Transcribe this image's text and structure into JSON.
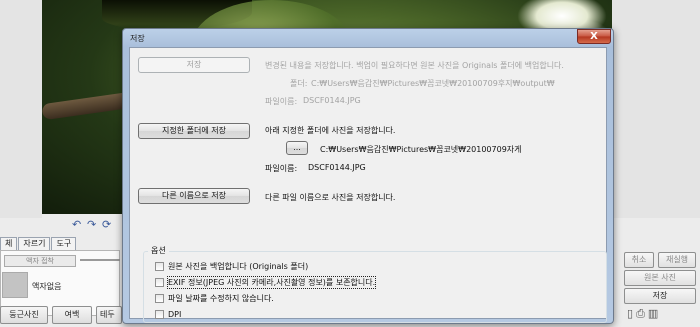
{
  "background": {
    "tabs": [
      "체",
      "자르기",
      "도구"
    ],
    "frame_select_placeholder": "액자 접착",
    "thumbnail_label": "액자없음",
    "bottom_buttons": [
      "둥근사진",
      "여백",
      "테두"
    ],
    "right_buttons": {
      "cancel": "취소",
      "reapply": "재실행",
      "original": "원본 사진",
      "save": "저장"
    },
    "toolbar_icons": [
      "undo-icon",
      "redo-icon",
      "rotate-icon"
    ]
  },
  "dialog": {
    "title": "저장",
    "close_label": "X",
    "save_button": "저장",
    "save_desc": "변경된 내용을 저장합니다. 백업이 필요하다면 원본 사진을 Originals 폴더에 백업합니다.",
    "folder_label": "폴더:",
    "folder_path": "C:₩Users₩음갑진₩Pictures₩꼽코넷₩20100709후지₩output₩",
    "filename_label_1": "파일이름:",
    "filename_1": "DSCF0144.JPG",
    "save_to_folder_button": "지정한 폴더에 저장",
    "save_to_folder_desc": "아래 지정한 폴더에 사진을 저장합니다.",
    "browse_button": "...",
    "target_path": "C:₩Users₩음갑진₩Pictures₩꼽코넷₩20100709자게",
    "filename_label_2": "파일이름:",
    "filename_2": "DSCF0144.JPG",
    "save_as_button": "다른 이름으로 저장",
    "save_as_desc": "다른 파일 이름으로 사진을 저장합니다.",
    "options_title": "옵션",
    "options": [
      {
        "label": "원본 사진을 백업합니다 (Originals 폴더)",
        "checked": false
      },
      {
        "label": "EXIF 정보(JPEG 사진의 카메라,사진촬영 정보)를 보존합니다.",
        "checked": false
      },
      {
        "label": "파일 날짜를 수정하지 않습니다.",
        "checked": false
      },
      {
        "label": "DPI",
        "checked": false
      }
    ]
  }
}
